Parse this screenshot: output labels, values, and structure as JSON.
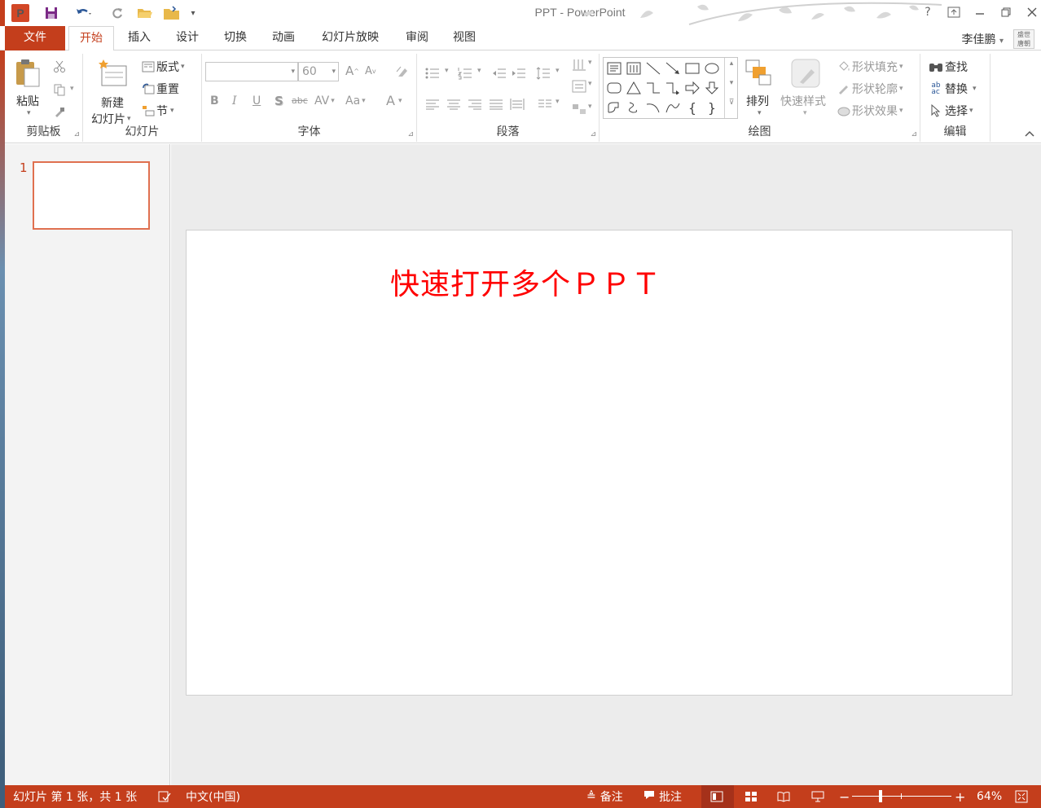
{
  "titlebar": {
    "app_icon_label": "P",
    "title": "PPT - PowerPoint",
    "icons": [
      "save-icon",
      "undo-icon",
      "redo-icon",
      "open-folder-icon",
      "folder-icon",
      "customize-qat-icon"
    ],
    "window_buttons": [
      "help-icon",
      "ribbon-display-icon",
      "minimize-icon",
      "restore-icon",
      "close-icon"
    ],
    "help_label": "?"
  },
  "tabs": {
    "file": "文件",
    "items": [
      "开始",
      "插入",
      "设计",
      "切换",
      "动画",
      "幻灯片放映",
      "审阅",
      "视图"
    ],
    "active": "开始"
  },
  "user": {
    "name": "李佳鹏",
    "avatar_text": "盛世\n唐朝"
  },
  "ribbon": {
    "clipboard": {
      "label": "剪贴板",
      "paste": "粘贴"
    },
    "slides": {
      "label": "幻灯片",
      "new_slide_line1": "新建",
      "new_slide_line2": "幻灯片",
      "layout": "版式",
      "reset": "重置",
      "section": "节"
    },
    "font": {
      "label": "字体",
      "font_name": "",
      "font_size": "60",
      "bold": "B",
      "italic": "I",
      "underline": "U",
      "shadow": "S",
      "strike": "abc",
      "spacing": "AV",
      "case": "Aa",
      "font_color": "A",
      "grow": "A",
      "shrink": "A"
    },
    "paragraph": {
      "label": "段落"
    },
    "drawing": {
      "label": "绘图",
      "arrange": "排列",
      "quick_styles": "快速样式",
      "shape_fill": "形状填充",
      "shape_outline": "形状轮廓",
      "shape_effects": "形状效果"
    },
    "editing": {
      "label": "编辑",
      "find": "查找",
      "replace": "替换",
      "select": "选择"
    }
  },
  "thumbnails": {
    "slide_number": "1"
  },
  "slide": {
    "title": "快速打开多个ＰＰＴ",
    "title_color": "#ff0000"
  },
  "statusbar": {
    "slide_info": "幻灯片 第 1 张，共 1 张",
    "language": "中文(中国)",
    "notes": "备注",
    "comments": "批注",
    "zoom_minus": "−",
    "zoom_plus": "+",
    "zoom": "64%",
    "zoom_fraction": 0.64
  },
  "colors": {
    "accent": "#c43e1c",
    "statusbar": "#c43e1c"
  }
}
